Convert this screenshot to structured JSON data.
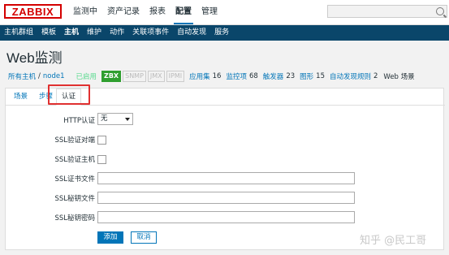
{
  "logo": "ZABBIX",
  "top_menu": [
    {
      "label": "监测中"
    },
    {
      "label": "资产记录"
    },
    {
      "label": "报表"
    },
    {
      "label": "配置",
      "active": true
    },
    {
      "label": "管理"
    }
  ],
  "sub_menu": [
    {
      "label": "主机群组"
    },
    {
      "label": "模板"
    },
    {
      "label": "主机",
      "active": true
    },
    {
      "label": "维护"
    },
    {
      "label": "动作"
    },
    {
      "label": "关联项事件"
    },
    {
      "label": "自动发现"
    },
    {
      "label": "服务"
    }
  ],
  "page_title": "Web监测",
  "breadcrumb": {
    "all_hosts": "所有主机",
    "sep": "/",
    "host": "node1",
    "status": "已启用",
    "tags": [
      "ZBX",
      "SNMP",
      "JMX",
      "IPMI"
    ],
    "links": [
      {
        "label": "应用集",
        "count": "16"
      },
      {
        "label": "监控项",
        "count": "68"
      },
      {
        "label": "触发器",
        "count": "23"
      },
      {
        "label": "图形",
        "count": "15"
      },
      {
        "label": "自动发现规则",
        "count": "2"
      }
    ],
    "current": "Web 场景"
  },
  "tabs": {
    "scenario": "场景",
    "steps": "步骤",
    "auth": "认证"
  },
  "form": {
    "http_auth_label": "HTTP认证",
    "http_auth_value": "无",
    "ssl_verify_peer_label": "SSL验证对端",
    "ssl_verify_host_label": "SSL验证主机",
    "ssl_cert_file_label": "SSL证书文件",
    "ssl_key_file_label": "SSL秘钥文件",
    "ssl_key_password_label": "SSL秘钥密码",
    "add_button": "添加",
    "cancel_button": "取消"
  },
  "watermark": "知乎 @民工哥",
  "colors": {
    "accent": "#0275b8",
    "nav_bar": "#0a466a",
    "logo_red": "#d40000",
    "enabled_green": "#59db8f",
    "zbx_green": "#2f9f2f",
    "highlight": "#e03030"
  }
}
